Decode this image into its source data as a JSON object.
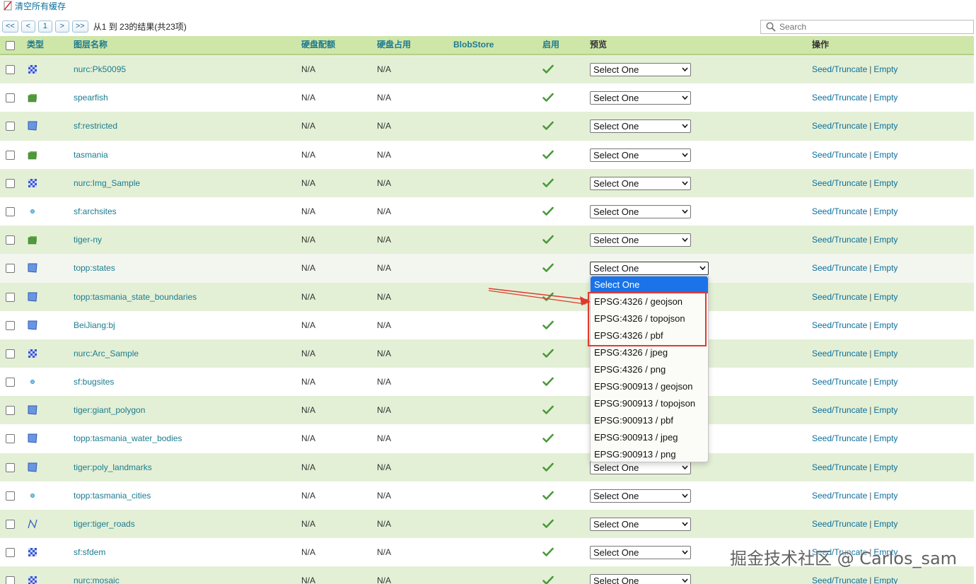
{
  "topbar": {
    "clear_cache_label": "清空所有缓存"
  },
  "pager": {
    "first": "<<",
    "prev": "<",
    "page": "1",
    "next": ">",
    "last": ">>",
    "info": "从1 到 23的结果(共23项)"
  },
  "search": {
    "placeholder": "Search"
  },
  "headers": {
    "type": "类型",
    "name": "图层名称",
    "quota": "硬盘配额",
    "usage": "硬盘占用",
    "blobstore": "BlobStore",
    "enabled": "启用",
    "preview": "预览",
    "actions": "操作"
  },
  "rows": [
    {
      "name": "nurc:Pk50095",
      "type": "raster",
      "quota": "N/A",
      "usage": "N/A",
      "preview": "Select One"
    },
    {
      "name": "spearfish",
      "type": "group",
      "quota": "N/A",
      "usage": "N/A",
      "preview": "Select One"
    },
    {
      "name": "sf:restricted",
      "type": "polygon",
      "quota": "N/A",
      "usage": "N/A",
      "preview": "Select One"
    },
    {
      "name": "tasmania",
      "type": "group",
      "quota": "N/A",
      "usage": "N/A",
      "preview": "Select One"
    },
    {
      "name": "nurc:Img_Sample",
      "type": "raster",
      "quota": "N/A",
      "usage": "N/A",
      "preview": "Select One"
    },
    {
      "name": "sf:archsites",
      "type": "point",
      "quota": "N/A",
      "usage": "N/A",
      "preview": "Select One"
    },
    {
      "name": "tiger-ny",
      "type": "group",
      "quota": "N/A",
      "usage": "N/A",
      "preview": "Select One"
    },
    {
      "name": "topp:states",
      "type": "polygon",
      "quota": "N/A",
      "usage": "N/A",
      "preview": "Select One"
    },
    {
      "name": "topp:tasmania_state_boundaries",
      "type": "polygon",
      "quota": "N/A",
      "usage": "N/A",
      "preview": ""
    },
    {
      "name": "BeiJiang:bj",
      "type": "polygon",
      "quota": "N/A",
      "usage": "N/A",
      "preview": ""
    },
    {
      "name": "nurc:Arc_Sample",
      "type": "raster",
      "quota": "N/A",
      "usage": "N/A",
      "preview": ""
    },
    {
      "name": "sf:bugsites",
      "type": "point",
      "quota": "N/A",
      "usage": "N/A",
      "preview": ""
    },
    {
      "name": "tiger:giant_polygon",
      "type": "polygon",
      "quota": "N/A",
      "usage": "N/A",
      "preview": ""
    },
    {
      "name": "topp:tasmania_water_bodies",
      "type": "polygon",
      "quota": "N/A",
      "usage": "N/A",
      "preview": ""
    },
    {
      "name": "tiger:poly_landmarks",
      "type": "polygon",
      "quota": "N/A",
      "usage": "N/A",
      "preview": "Select One"
    },
    {
      "name": "topp:tasmania_cities",
      "type": "point",
      "quota": "N/A",
      "usage": "N/A",
      "preview": "Select One"
    },
    {
      "name": "tiger:tiger_roads",
      "type": "line",
      "quota": "N/A",
      "usage": "N/A",
      "preview": "Select One"
    },
    {
      "name": "sf:sfdem",
      "type": "raster",
      "quota": "N/A",
      "usage": "N/A",
      "preview": "Select One"
    },
    {
      "name": "nurc:mosaic",
      "type": "raster",
      "quota": "N/A",
      "usage": "N/A",
      "preview": "Select One"
    }
  ],
  "actions": {
    "seed": "Seed/Truncate",
    "sep": "|",
    "empty": "Empty"
  },
  "dropdown": {
    "options": [
      "Select One",
      "EPSG:4326 / geojson",
      "EPSG:4326 / topojson",
      "EPSG:4326 / pbf",
      "EPSG:4326 / jpeg",
      "EPSG:4326 / png",
      "EPSG:900913 / geojson",
      "EPSG:900913 / topojson",
      "EPSG:900913 / pbf",
      "EPSG:900913 / jpeg",
      "EPSG:900913 / png"
    ]
  },
  "colors": {
    "header_bg": "#cfe6a9",
    "row_alt": "#e4f0d6",
    "link": "#0b6f9c",
    "highlight": "#1a73e8",
    "annotation": "#e03a2e"
  },
  "watermark": "掘金技术社区 @ Carlos_sam"
}
